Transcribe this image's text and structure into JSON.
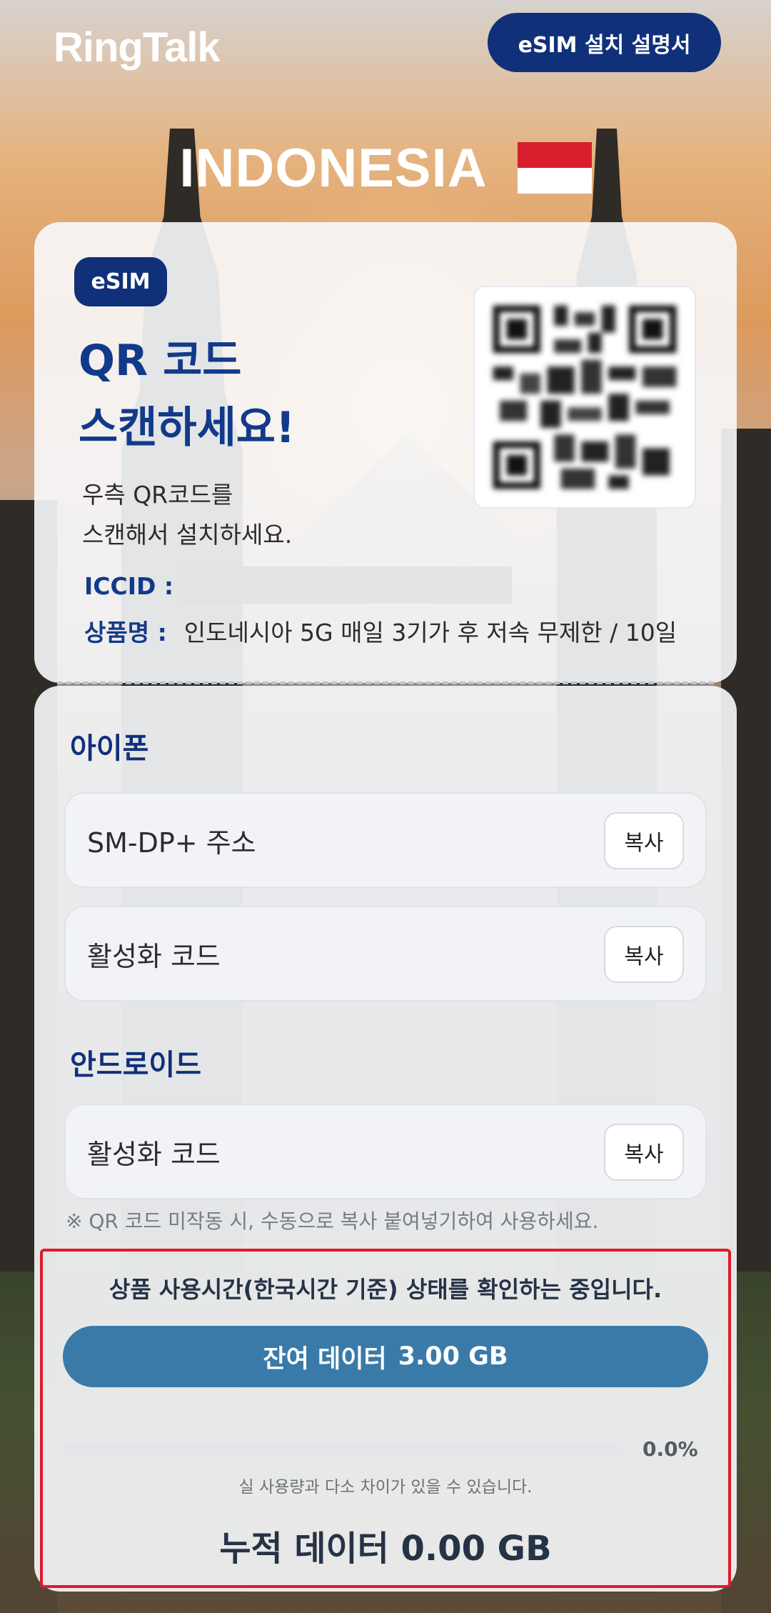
{
  "header": {
    "logo_text": "RingTalk",
    "guide_button_label": "eSIM 설치 설명서"
  },
  "country": {
    "name": "INDONESIA",
    "flag_icon": "indonesia-flag-icon",
    "flag_colors": {
      "top": "#d81e2c",
      "bottom": "#ffffff"
    }
  },
  "qr_card": {
    "badge_label": "eSIM",
    "title_line1": "QR 코드",
    "title_line2": "스캔하세요!",
    "desc_line1": "우측 QR코드를",
    "desc_line2": "스캔해서 설치하세요.",
    "iccid_label": "ICCID :",
    "product_label": "상품명 :",
    "product_value": "인도네시아 5G 매일 3기가 후 저속 무제한 / 10일"
  },
  "iphone": {
    "section_title": "아이폰",
    "fields": [
      {
        "label": "SM-DP+ 주소",
        "copy_label": "복사"
      },
      {
        "label": "활성화 코드",
        "copy_label": "복사"
      }
    ]
  },
  "android": {
    "section_title": "안드로이드",
    "fields": [
      {
        "label": "활성화 코드",
        "copy_label": "복사"
      }
    ]
  },
  "note": "※ QR 코드 미작동 시, 수동으로 복사 붙여넣기하여 사용하세요.",
  "status": {
    "title": "상품 사용시간(한국시간 기준) 상태를 확인하는 중입니다.",
    "remaining_label": "잔여 데이터",
    "remaining_value": "3.00 GB",
    "progress_percent": 0.0,
    "progress_text": "0.0%",
    "disclaimer": "실 사용량과 다소 차이가 있을 수 있습니다.",
    "cumulative_text": "누적 데이터 0.00 GB"
  },
  "colors": {
    "brand_navy": "#10307a",
    "accent_blue": "#3a7aa9",
    "highlight_red": "#e01a2a"
  }
}
